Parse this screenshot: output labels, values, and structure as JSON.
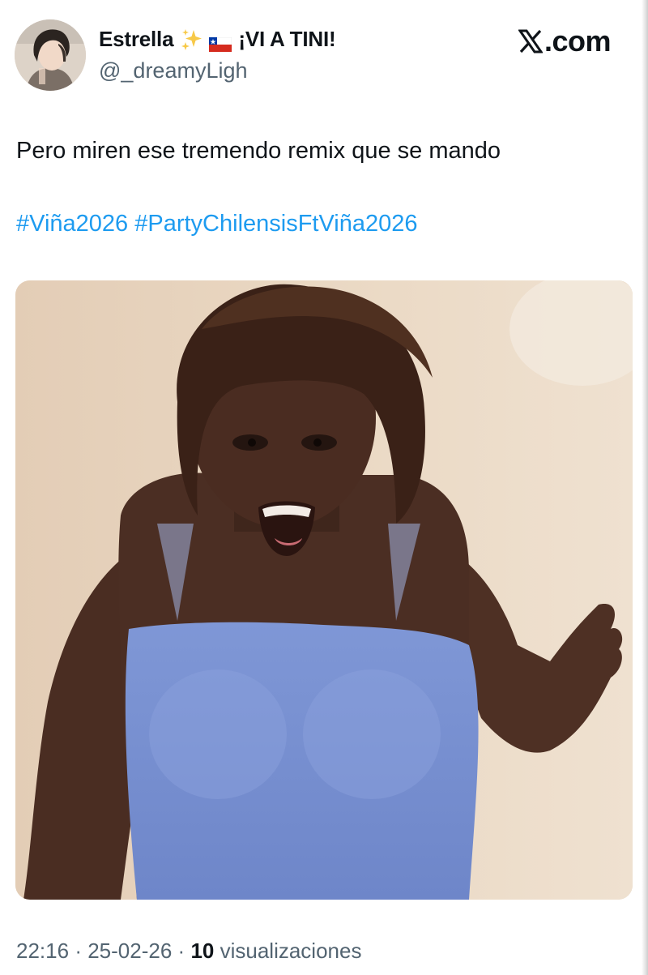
{
  "author": {
    "display_name": "Estrella",
    "name_suffix": "¡VI A TINI!",
    "handle": "@_dreamyLigh",
    "avatar_icon": "profile-photo",
    "emoji": [
      "sparkles-icon",
      "chile-flag-icon"
    ]
  },
  "brand": {
    "logo_icon": "x-logo-icon",
    "label": ".com"
  },
  "tweet": {
    "text": "Pero miren ese tremendo remix que se mando",
    "hashtags": [
      "#Viña2026",
      "#PartyChilensisFtViña2026"
    ]
  },
  "media": {
    "type": "photo"
  },
  "meta": {
    "time": "22:16",
    "separator": "·",
    "date": "25-02-26",
    "views_count": "10",
    "views_label": "visualizaciones"
  },
  "colors": {
    "hashtag": "#1d9bf0",
    "text": "#0f1419",
    "secondary": "#536471",
    "background": "#ffffff"
  }
}
